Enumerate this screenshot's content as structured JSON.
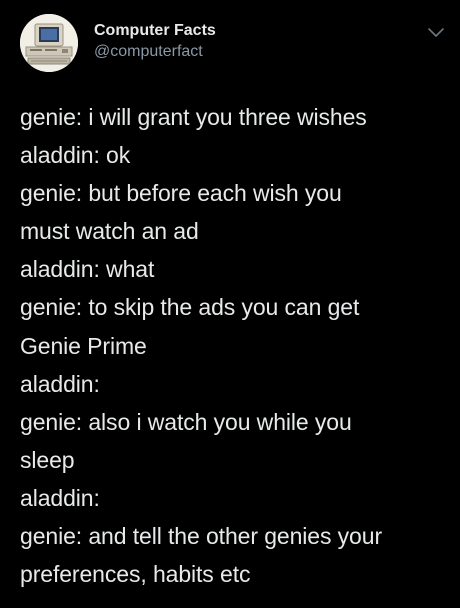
{
  "author": {
    "display_name": "Computer Facts",
    "handle": "@computerfact",
    "avatar_icon": "vintage-computer-icon"
  },
  "menu": {
    "icon": "chevron-down-icon"
  },
  "tweet": {
    "lines": [
      "genie: i will grant you three wishes",
      "aladdin: ok",
      "genie: but before each wish you",
      "must watch an ad",
      "aladdin: what",
      "genie: to skip the ads you can get",
      "Genie Prime",
      "aladdin:",
      "genie: also i watch you while you",
      "sleep",
      "aladdin:",
      "genie: and tell the other genies your",
      "preferences, habits etc"
    ]
  },
  "colors": {
    "background": "#000000",
    "text": "#e7e9ea",
    "secondary_text": "#8b98a5"
  }
}
